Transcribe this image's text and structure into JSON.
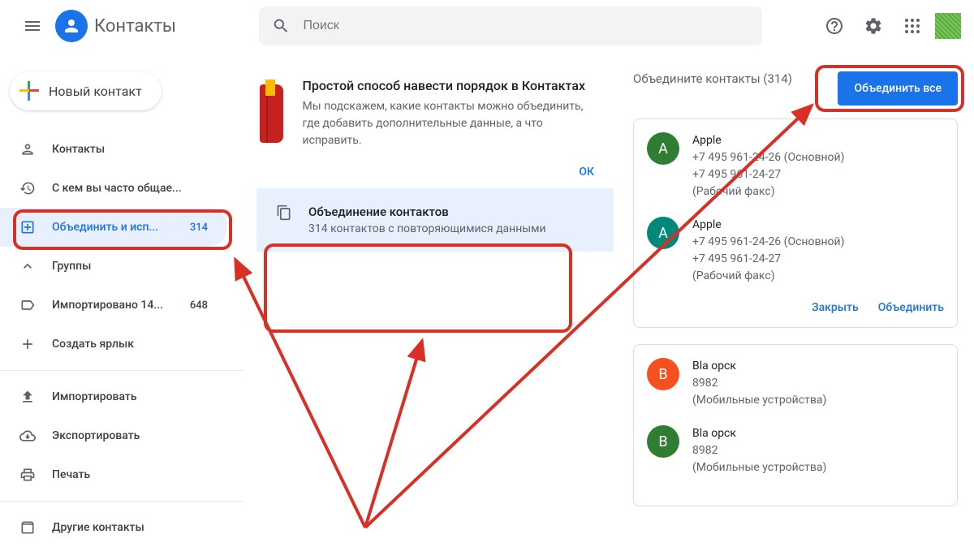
{
  "header": {
    "title": "Контакты",
    "search_placeholder": "Поиск"
  },
  "sidebar": {
    "new_contact": "Новый контакт",
    "items": [
      {
        "icon": "person",
        "label": "Контакты",
        "count": ""
      },
      {
        "icon": "history",
        "label": "С кем вы часто общае...",
        "count": ""
      },
      {
        "icon": "merge",
        "label": "Объединить и исп...",
        "count": "314",
        "active": true
      },
      {
        "icon": "chevron-up",
        "label": "Группы",
        "count": ""
      },
      {
        "icon": "label",
        "label": "Импортировано 14...",
        "count": "648"
      },
      {
        "icon": "plus",
        "label": "Создать ярлык",
        "count": ""
      },
      {
        "icon": "upload",
        "label": "Импортировать",
        "count": ""
      },
      {
        "icon": "download",
        "label": "Экспортировать",
        "count": ""
      },
      {
        "icon": "print",
        "label": "Печать",
        "count": ""
      },
      {
        "icon": "archive",
        "label": "Другие контакты",
        "count": ""
      }
    ]
  },
  "main": {
    "tidy": {
      "title": "Простой способ навести порядок в Контактах",
      "desc": "Мы подскажем, какие контакты можно объединить, где добавить дополнительные данные, а что исправить.",
      "ok": "ОК"
    },
    "merge_card": {
      "title": "Объединение контактов",
      "desc": "314 контактов с повторяющимися данными"
    }
  },
  "right": {
    "header_text": "Объедините контакты (314)",
    "merge_all": "Объединить все",
    "cards": [
      {
        "rows": [
          {
            "avatar": "A",
            "color": "#2e7d32",
            "name": "Apple",
            "line2": "+7 495 961-24-26 (Основной)",
            "line3": "+7 495 961-24-27",
            "line4": "(Рабочий факс)"
          },
          {
            "avatar": "A",
            "color": "#00897b",
            "name": "Apple",
            "line2": "+7 495 961-24-26 (Основной)",
            "line3": "+7 495 961-24-27",
            "line4": "(Рабочий факс)"
          }
        ],
        "close": "Закрыть",
        "merge": "Объединить"
      },
      {
        "rows": [
          {
            "avatar": "B",
            "color": "#f4511e",
            "name": "Bla                          орск",
            "line2": "8982",
            "line3": "(Мобильные устройства)",
            "line4": ""
          },
          {
            "avatar": "B",
            "color": "#2e7d32",
            "name": "Bla                          орск",
            "line2": "8982",
            "line3": "(Мобильные устройства)",
            "line4": ""
          }
        ],
        "close": "",
        "merge": ""
      }
    ]
  }
}
